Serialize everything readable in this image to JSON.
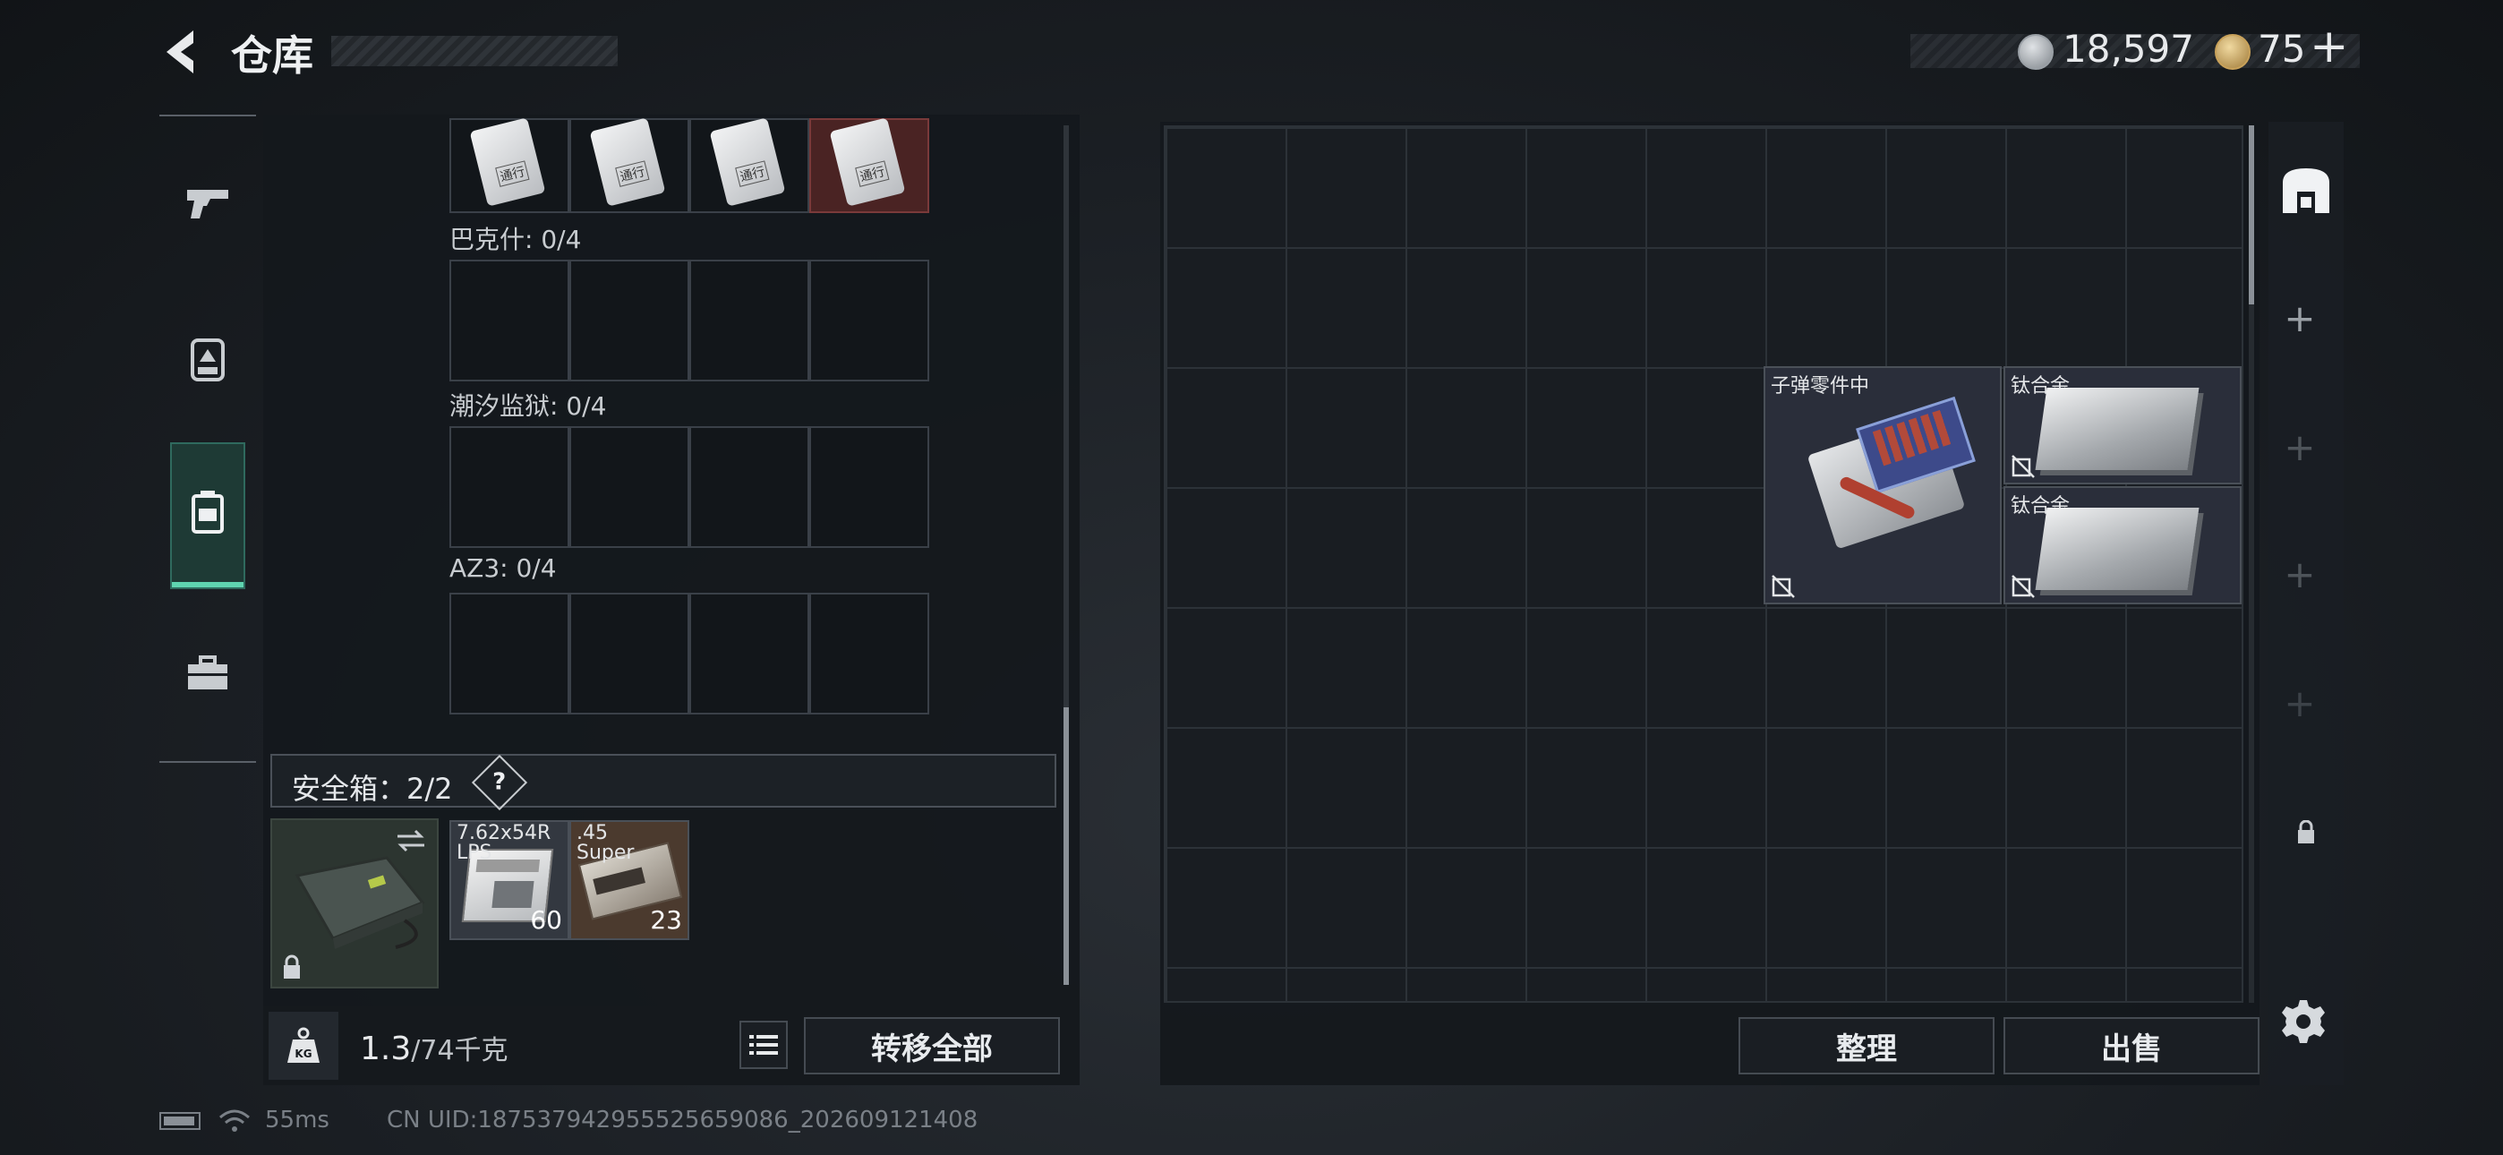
{
  "header": {
    "back_icon": "chevron-left-icon",
    "title": "仓库",
    "currency_silver": "18,597",
    "currency_gold": "75",
    "currency_gold_plus": "+"
  },
  "side_tabs": [
    {
      "icon": "pistol-icon",
      "active": false
    },
    {
      "icon": "armor-rig-icon",
      "active": false
    },
    {
      "icon": "backpack-icon",
      "active": true
    },
    {
      "icon": "toolbox-icon",
      "active": false
    }
  ],
  "left_panel": {
    "groups": [
      {
        "label": "巴克什: 0/4"
      },
      {
        "label": "潮汐监狱: 0/4"
      },
      {
        "label": "AZ3: 0/4"
      }
    ],
    "card_badge": "通行",
    "safe_box": {
      "label": "安全箱：2/2",
      "help": "?"
    },
    "safe_items": [
      {
        "name": "7.62x54R LPS",
        "qty": "60"
      },
      {
        "name": ".45 Super",
        "qty": "23"
      }
    ],
    "weight": {
      "current": "1.3",
      "max": "/74千克",
      "icon": "kg-weight-icon"
    },
    "list_icon": "list-icon",
    "transfer_all": "转移全部"
  },
  "stash": {
    "items": [
      {
        "name": "子弹零件中"
      },
      {
        "name": "钛合金"
      },
      {
        "name": "钛合金"
      }
    ],
    "buttons": {
      "organize": "整理",
      "sell": "出售"
    }
  },
  "right_rail": {
    "home_icon": "stash-home-icon",
    "plus": "+",
    "lock_icon": "lock-icon",
    "settings_icon": "gear-icon"
  },
  "status_bar": {
    "ping": "55ms",
    "uid": "CN UID:1875379429555256590​86_202609121408"
  }
}
